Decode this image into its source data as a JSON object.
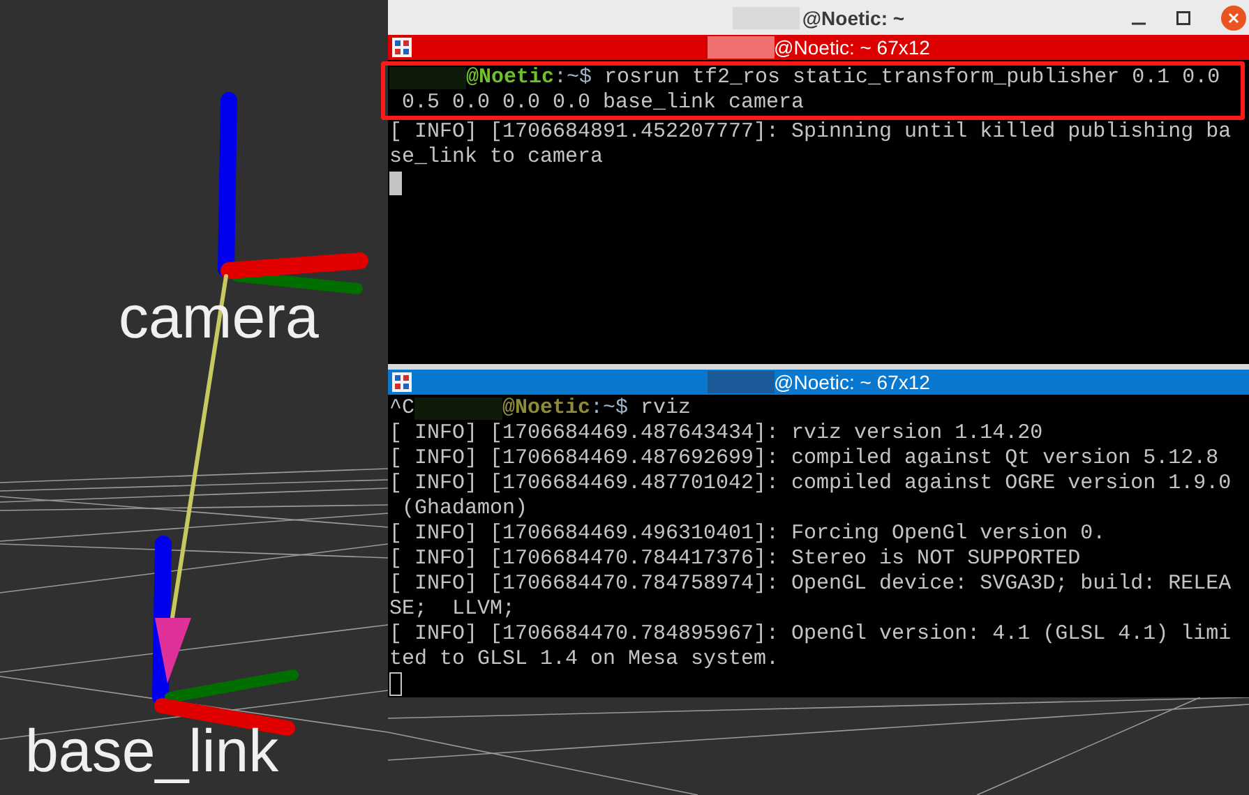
{
  "scene": {
    "frames": [
      {
        "label": "camera"
      },
      {
        "label": "base_link"
      }
    ]
  },
  "window": {
    "title": "@Noetic: ~"
  },
  "panes": [
    {
      "title": "@Noetic: ~ 67x12",
      "focused": true,
      "highlighted_lines": [
        {
          "kind": "prompt",
          "host": "@Noetic",
          "path": ":~$",
          "command": " rosrun tf2_ros static_transform_publisher 0.1 0.0"
        },
        {
          "kind": "output",
          "text": " 0.5 0.0 0.0 0.0 base_link camera"
        }
      ],
      "lines": [
        {
          "kind": "output",
          "text": "[ INFO] [1706684891.452207777]: Spinning until killed publishing ba"
        },
        {
          "kind": "output",
          "text": "se_link to camera"
        },
        {
          "kind": "cursor"
        }
      ]
    },
    {
      "title": "@Noetic: ~ 67x12",
      "focused": false,
      "lines": [
        {
          "kind": "prompt",
          "prefix": "^C",
          "host": "@Noetic",
          "path": ":~$",
          "command": " rviz"
        },
        {
          "kind": "output",
          "text": "[ INFO] [1706684469.487643434]: rviz version 1.14.20"
        },
        {
          "kind": "output",
          "text": "[ INFO] [1706684469.487692699]: compiled against Qt version 5.12.8"
        },
        {
          "kind": "output",
          "text": "[ INFO] [1706684469.487701042]: compiled against OGRE version 1.9.0"
        },
        {
          "kind": "output",
          "text": " (Ghadamon)"
        },
        {
          "kind": "output",
          "text": "[ INFO] [1706684469.496310401]: Forcing OpenGl version 0."
        },
        {
          "kind": "output",
          "text": "[ INFO] [1706684470.784417376]: Stereo is NOT SUPPORTED"
        },
        {
          "kind": "output",
          "text": "[ INFO] [1706684470.784758974]: OpenGL device: SVGA3D; build: RELEA"
        },
        {
          "kind": "output",
          "text": "SE;  LLVM;"
        },
        {
          "kind": "output",
          "text": "[ INFO] [1706684470.784895967]: OpenGl version: 4.1 (GLSL 4.1) limi"
        },
        {
          "kind": "output",
          "text": "ted to GLSL 1.4 on Mesa system."
        },
        {
          "kind": "cursor"
        }
      ]
    }
  ]
}
